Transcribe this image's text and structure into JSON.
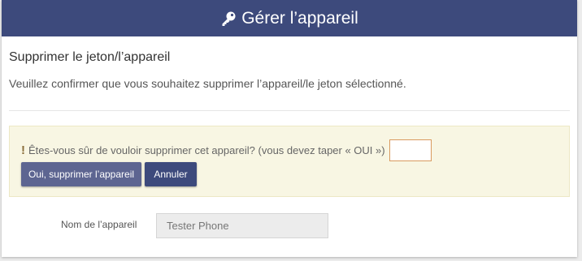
{
  "header": {
    "icon": "key-icon",
    "title": "Gérer l’appareil"
  },
  "section": {
    "title": "Supprimer le jeton/l’appareil",
    "description": "Veuillez confirmer que vous souhaitez supprimer l’appareil/le jeton sélectionné."
  },
  "warning": {
    "icon": "exclamation-icon",
    "text": "Êtes-vous sûr de vouloir supprimer cet appareil? (vous devez taper « OUI »)",
    "input_value": ""
  },
  "buttons": {
    "delete_label": "Oui, supprimer l’appareil",
    "cancel_label": "Annuler"
  },
  "device": {
    "name_label": "Nom de l’appareil",
    "name_value": "Tester Phone"
  },
  "colors": {
    "header_bg": "#3d4a7c",
    "warning_bg": "#f8f6e3",
    "delete_button": "#5d6591",
    "cancel_button": "#3d4a7c",
    "input_focus_border": "#d99a5f"
  }
}
